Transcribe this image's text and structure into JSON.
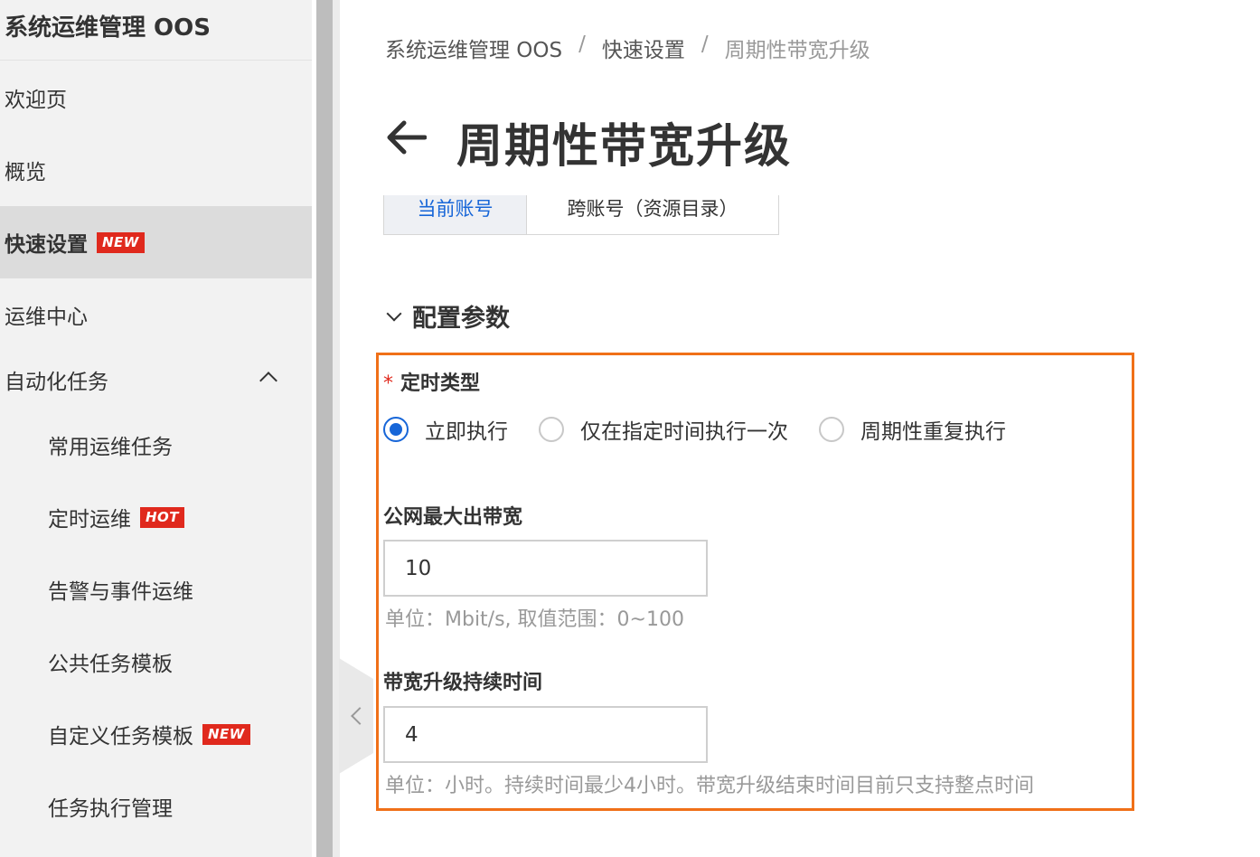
{
  "sidebar": {
    "title": "系统运维管理 OOS",
    "items": [
      {
        "label": "欢迎页"
      },
      {
        "label": "概览"
      },
      {
        "label": "快速设置",
        "badge": "NEW"
      },
      {
        "label": "运维中心"
      },
      {
        "label": "自动化任务"
      },
      {
        "label": "常用运维任务"
      },
      {
        "label": "定时运维",
        "badge": "HOT"
      },
      {
        "label": "告警与事件运维"
      },
      {
        "label": "公共任务模板"
      },
      {
        "label": "自定义任务模板",
        "badge": "NEW"
      },
      {
        "label": "任务执行管理"
      }
    ]
  },
  "breadcrumb": {
    "items": [
      "系统运维管理 OOS",
      "快速设置",
      "周期性带宽升级"
    ],
    "separator": "/"
  },
  "page": {
    "title": "周期性带宽升级"
  },
  "tabs": [
    {
      "label": "当前账号"
    },
    {
      "label": "跨账号（资源目录）"
    }
  ],
  "section": {
    "title": "配置参数"
  },
  "form": {
    "schedule_type": {
      "required_mark": "*",
      "label": "定时类型",
      "options": [
        "立即执行",
        "仅在指定时间执行一次",
        "周期性重复执行"
      ],
      "selected": "立即执行"
    },
    "max_bandwidth": {
      "label": "公网最大出带宽",
      "value": "10",
      "help": "单位：Mbit/s, 取值范围：0~100"
    },
    "duration": {
      "label": "带宽升级持续时间",
      "value": "4",
      "help": "单位：小时。持续时间最少4小时。带宽升级结束时间目前只支持整点时间"
    }
  },
  "colors": {
    "primary": "#1766d8",
    "badge": "#e0291d",
    "highlight": "#f07018"
  }
}
